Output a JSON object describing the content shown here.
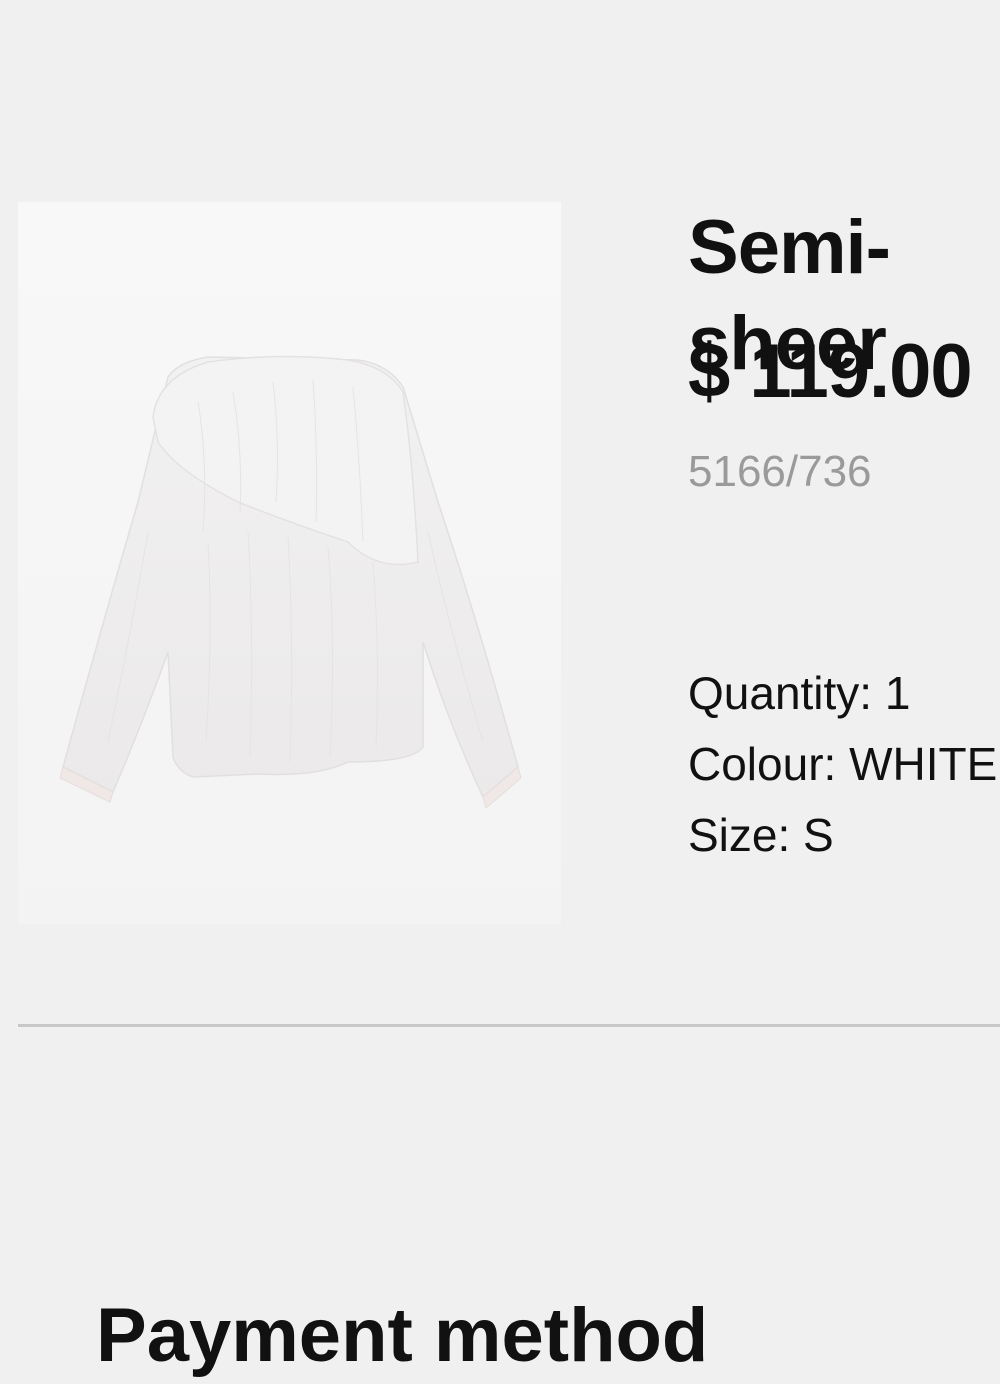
{
  "product": {
    "name": "Semi-sheer",
    "price": "$ 119.00",
    "reference": "5166/736",
    "quantity_label": "Quantity:",
    "quantity_value": "1",
    "colour_label": "Colour:",
    "colour_value": "WHITE",
    "size_label": "Size:",
    "size_value": "S",
    "image_icon": "blouse-photo"
  },
  "payment": {
    "title": "Payment method"
  },
  "colors": {
    "background": "#f0f0f0",
    "text": "#111111",
    "muted": "#9a9a9a",
    "divider": "#c8c8c8"
  }
}
